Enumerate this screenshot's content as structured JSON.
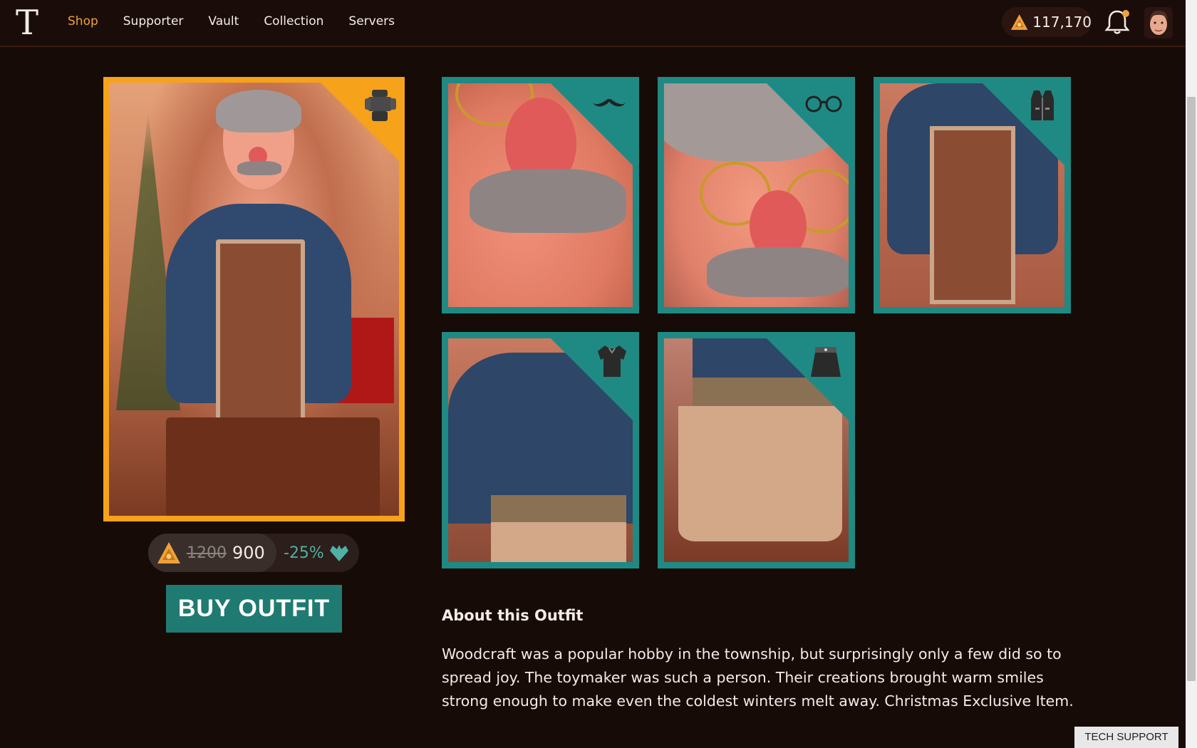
{
  "nav": {
    "logo": "T",
    "items": [
      {
        "label": "Shop",
        "active": true
      },
      {
        "label": "Supporter",
        "active": false
      },
      {
        "label": "Vault",
        "active": false
      },
      {
        "label": "Collection",
        "active": false
      },
      {
        "label": "Servers",
        "active": false
      }
    ],
    "currency_amount": "117,170",
    "icons": [
      "currency-icon",
      "bell-icon",
      "avatar"
    ]
  },
  "outfit": {
    "slot_icon": "outfit-icon",
    "old_price": "1200",
    "new_price": "900",
    "discount": "-25%",
    "buy_label": "BUY OUTFIT"
  },
  "pieces": [
    {
      "slot_icon": "mustache-icon"
    },
    {
      "slot_icon": "glasses-icon"
    },
    {
      "slot_icon": "vest-icon"
    },
    {
      "slot_icon": "shirt-icon"
    },
    {
      "slot_icon": "skirt-icon"
    }
  ],
  "about": {
    "title": "About this Outfit",
    "text": "Woodcraft was a popular hobby in the township, but surprisingly only a few did so to spread joy. The toymaker was such a person. Their creations brought warm smiles strong enough to make even the coldest winters melt away. Christmas Exclusive Item."
  },
  "tech_support_label": "TECH SUPPORT",
  "colors": {
    "accent_orange": "#f0a23a",
    "card_gold": "#f6a21a",
    "card_teal": "#1e8a83",
    "buy_button": "#1f7a72",
    "background": "#170b07"
  }
}
